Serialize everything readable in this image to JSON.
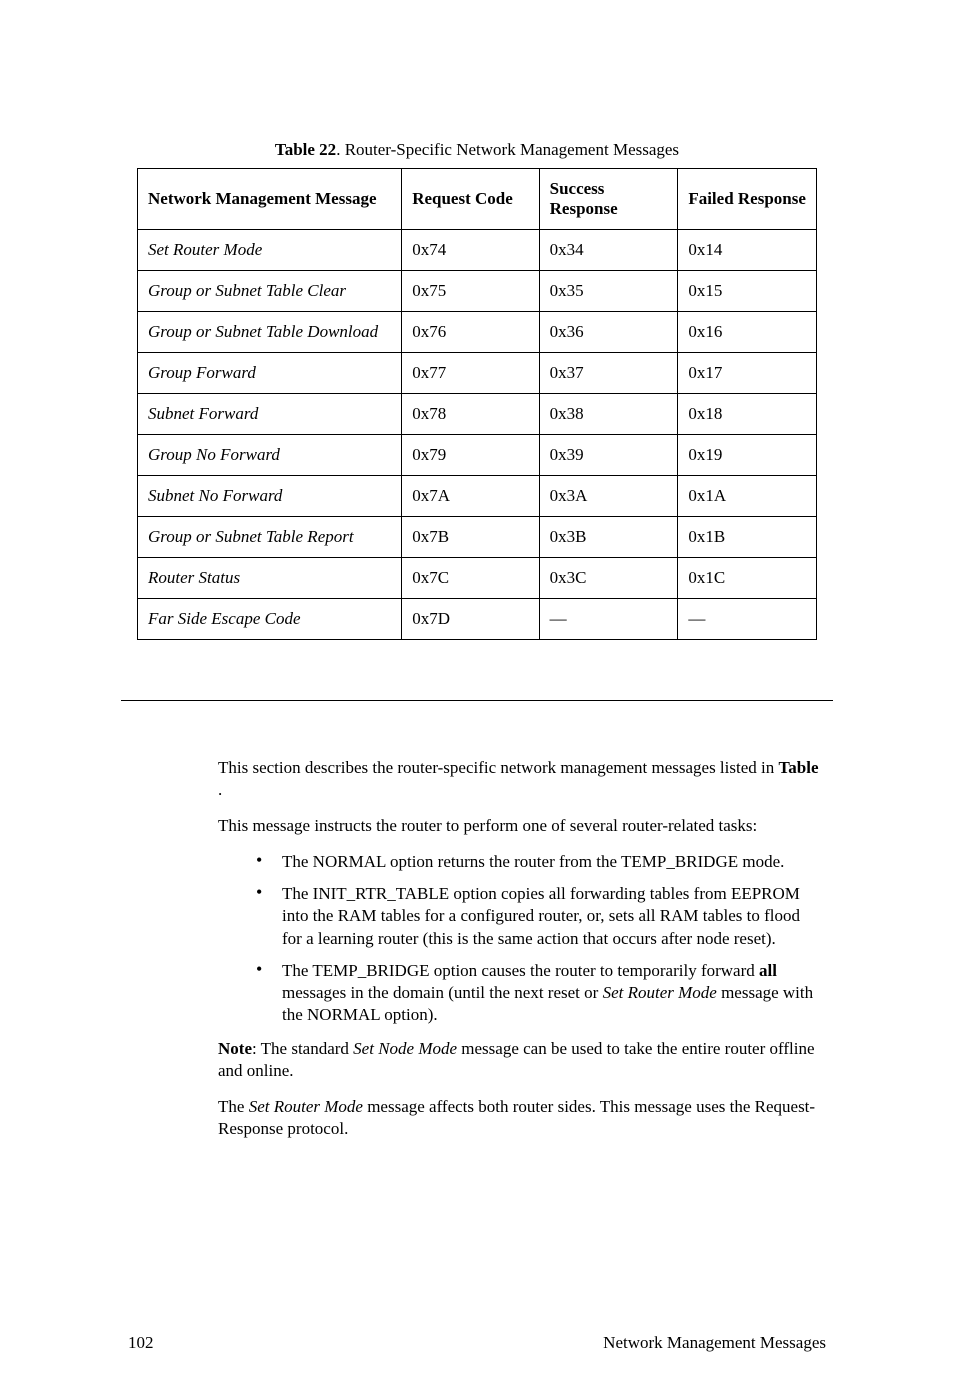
{
  "table": {
    "caption_bold": "Table 22",
    "caption_rest": ". Router-Specific Network Management Messages",
    "headers": {
      "msg": "Network Management Message",
      "req": "Request Code",
      "succ": "Success Response",
      "fail": "Failed Response"
    },
    "rows": [
      {
        "msg": "Set Router Mode",
        "req": "0x74",
        "succ": "0x34",
        "fail": "0x14"
      },
      {
        "msg": "Group or Subnet Table Clear",
        "req": "0x75",
        "succ": "0x35",
        "fail": "0x15"
      },
      {
        "msg": "Group or Subnet Table Download",
        "req": "0x76",
        "succ": "0x36",
        "fail": "0x16"
      },
      {
        "msg": "Group Forward",
        "req": "0x77",
        "succ": "0x37",
        "fail": "0x17"
      },
      {
        "msg": "Subnet Forward",
        "req": "0x78",
        "succ": "0x38",
        "fail": "0x18"
      },
      {
        "msg": "Group No Forward",
        "req": "0x79",
        "succ": "0x39",
        "fail": "0x19"
      },
      {
        "msg": "Subnet No Forward",
        "req": "0x7A",
        "succ": "0x3A",
        "fail": "0x1A"
      },
      {
        "msg": "Group or Subnet Table Report",
        "req": "0x7B",
        "succ": "0x3B",
        "fail": "0x1B"
      },
      {
        "msg": "Router Status",
        "req": "0x7C",
        "succ": "0x3C",
        "fail": "0x1C"
      },
      {
        "msg": "Far Side Escape Code",
        "req": "0x7D",
        "succ": "—",
        "fail": "—"
      }
    ]
  },
  "body": {
    "intro1_a": "This section describes the router-specific network management messages listed in ",
    "intro1_bold": "Table ",
    "intro1_b": ".",
    "intro2": "This message instructs the router to perform one of several router-related tasks:",
    "bullets": {
      "b1": "The NORMAL option returns the router from the TEMP_BRIDGE mode.",
      "b2": "The INIT_RTR_TABLE option copies all forwarding tables from EEPROM into the RAM tables for a configured router, or, sets all RAM tables to flood for a learning router (this is the same action that occurs after node reset).",
      "b3_a": "The TEMP_BRIDGE option causes the router to temporarily forward ",
      "b3_bold": "all",
      "b3_b": " messages in the domain (until the next reset or ",
      "b3_ital": "Set Router Mode",
      "b3_c": " message with the NORMAL option)."
    },
    "note_bold": "Note",
    "note_a": ":  The standard ",
    "note_ital": "Set Node Mode",
    "note_b": " message can be used to take the entire router offline and online.",
    "last_a": "The ",
    "last_ital": "Set Router Mode",
    "last_b": " message affects both router sides.  This message uses the Request-Response protocol."
  },
  "footer": {
    "page": "102",
    "title": "Network Management Messages"
  }
}
